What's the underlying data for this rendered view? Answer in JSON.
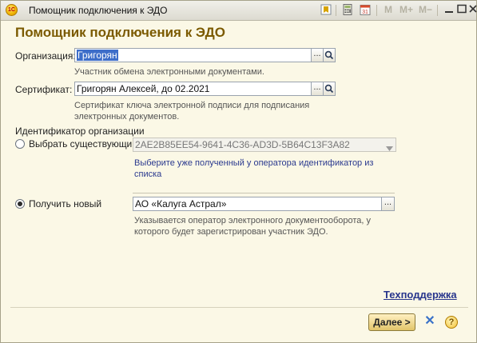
{
  "window": {
    "title": "Помощник подключения к ЭДО",
    "app_icon": "1С"
  },
  "toolbar": {
    "mem_m": "M",
    "mem_mplus": "M+",
    "mem_mminus": "M−",
    "icons": [
      "bookmark-icon",
      "calculator-icon",
      "calendar-icon",
      "minimize-icon",
      "maximize-icon",
      "close-icon"
    ],
    "calendar_label": "31"
  },
  "heading": "Помощник подключения к ЭДО",
  "organization": {
    "label": "Организация:",
    "value": "Григорян",
    "hint": "Участник обмена электронными документами.",
    "select_button": "...",
    "search_icon": "magnifier-icon"
  },
  "certificate": {
    "label": "Сертификат:",
    "value": "Григорян Алексей, до 02.2021",
    "hint_line1": "Сертификат ключа электронной подписи для подписания",
    "hint_line2": "электронных документов.",
    "select_button": "..."
  },
  "identifier": {
    "section_label": "Идентификатор организации",
    "existing_label": "Выбрать существующий",
    "existing_value": "2AE2B85EE54-9641-4C36-AD3D-5B64C13F3A82",
    "existing_hint_line1": "Выберите уже полученный у оператора идентификатор из",
    "existing_hint_line2": "списка",
    "new_label": "Получить новый",
    "new_value": "АО «Калуга Астрал»",
    "new_hint_line1": "Указывается оператор электронного документооборота, у",
    "new_hint_line2": "которого будет зарегистрирован участник ЭДО.",
    "selected": "new"
  },
  "support_link": "Техподдержка",
  "buttons": {
    "next": "Далее >",
    "close_symbol": "✕",
    "help_symbol": "?"
  },
  "colors": {
    "heading": "#7b5a00",
    "link": "#27358c",
    "selection": "#3d6ec9",
    "window_bg": "#fbf8e6"
  }
}
